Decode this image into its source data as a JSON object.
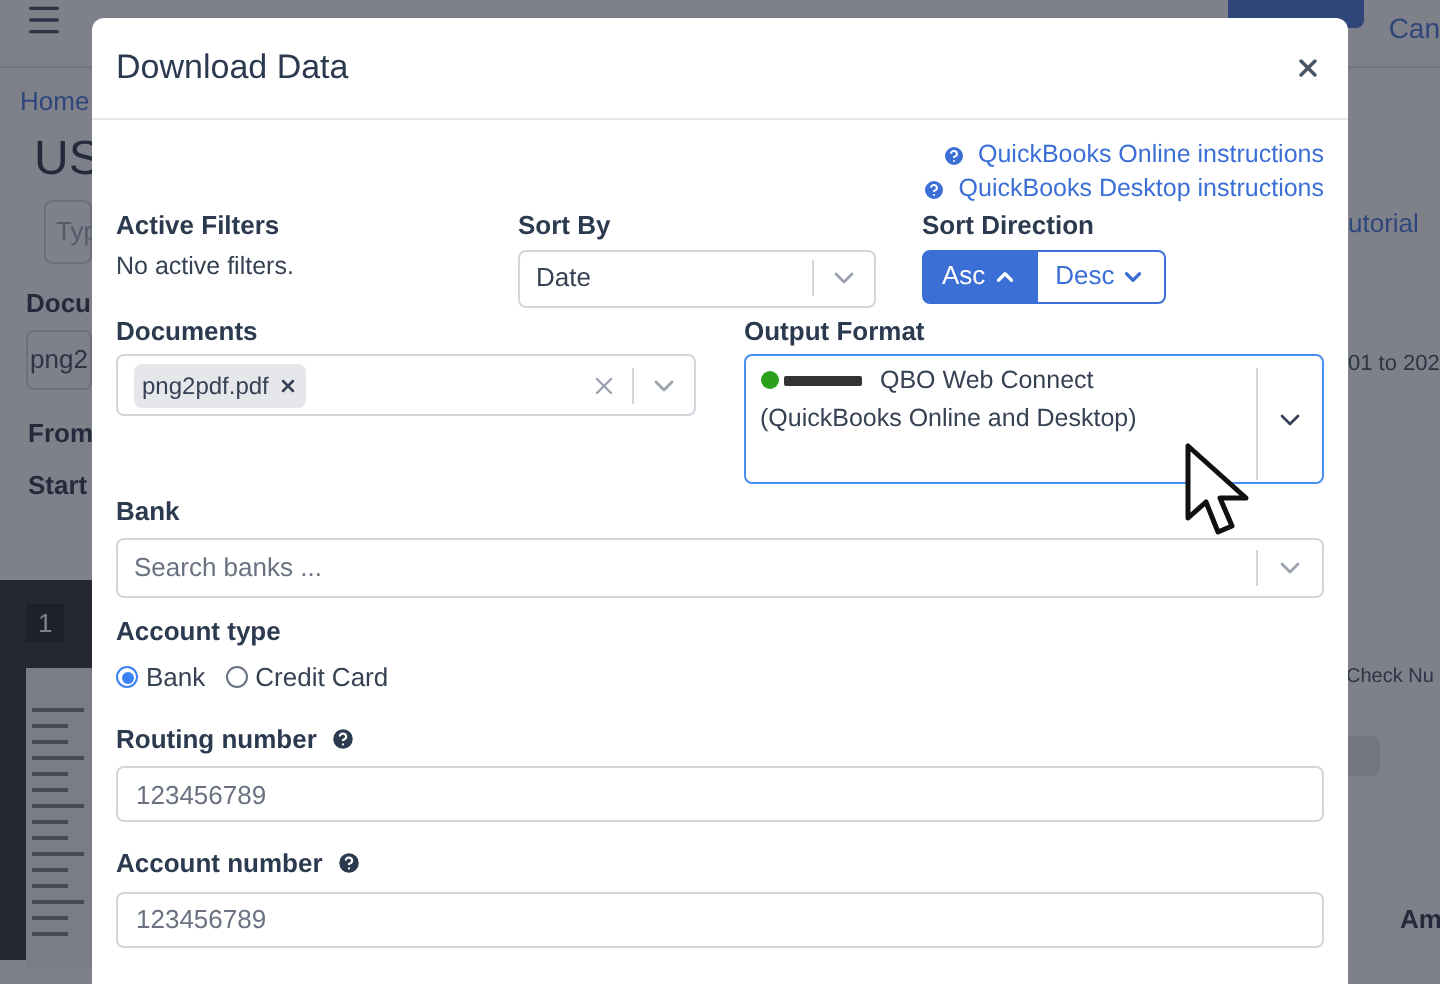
{
  "background": {
    "cancel_fragment": "Can",
    "breadcrumb": "Home",
    "heading": "US",
    "search_fragment": "Typ",
    "documents_label": "Docu",
    "documents_value": "png2",
    "from_label": "From",
    "start_label": "Start",
    "page_number": "1",
    "tutorial_fragment": "utorial",
    "date_fragment": "01 to 202",
    "check_fragment": "Check Nu",
    "amount_fragment": "Am"
  },
  "modal": {
    "title": "Download Data",
    "links": [
      "QuickBooks Online instructions",
      "QuickBooks Desktop instructions"
    ],
    "active_filters": {
      "label": "Active Filters",
      "text": "No active filters."
    },
    "sort_by": {
      "label": "Sort By",
      "value": "Date"
    },
    "sort_direction": {
      "label": "Sort Direction",
      "options": [
        {
          "label": "Asc",
          "kind": "up",
          "selected": true
        },
        {
          "label": "Desc",
          "kind": "down",
          "selected": false
        }
      ]
    },
    "documents": {
      "label": "Documents",
      "chips": [
        "png2pdf.pdf"
      ]
    },
    "output_format": {
      "label": "Output Format",
      "value": "QBO Web Connect (QuickBooks Online and Desktop)"
    },
    "bank": {
      "label": "Bank",
      "placeholder": "Search banks ..."
    },
    "account_type": {
      "label": "Account type",
      "options": [
        {
          "label": "Bank",
          "selected": true
        },
        {
          "label": "Credit Card",
          "selected": false
        }
      ]
    },
    "fields": [
      {
        "label": "Routing number",
        "placeholder": "123456789"
      },
      {
        "label": "Account number",
        "placeholder": "123456789"
      }
    ]
  }
}
